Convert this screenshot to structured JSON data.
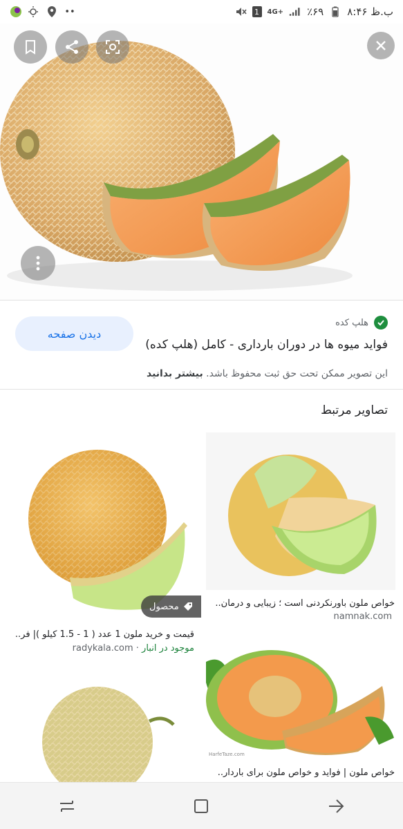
{
  "status_bar": {
    "time": "۸:۴۶ ب.ظ",
    "battery": "٪۶۹",
    "network": "4G+",
    "sim": "1"
  },
  "hero": {
    "image_alt": "melon"
  },
  "result": {
    "source": "هلپ کده",
    "title": "فواید میوه ها در دوران بارداری - کامل (هلپ کده)",
    "visit_button": "دیدن صفحه",
    "copyright": "این تصویر ممکن تحت حق ثبت محفوظ باشد.",
    "learn_more": "بیشتر بدانید"
  },
  "related": {
    "heading": "تصاویر مرتبط",
    "items": [
      {
        "caption": "خواص ملون باورنکردنی است ؛ زیبایی و درمان..",
        "site": "namnak.com"
      },
      {
        "caption": "قیمت و خرید ملون 1 عدد ( 1 - 1.5 کیلو )| فر..",
        "site": "radykala.com",
        "stock": "موجود در انبار",
        "tag": "محصول"
      },
      {
        "caption": "خواص ملون | فواید و خواص ملون برای باردار..",
        "watermark": "HarfeTaze.com"
      },
      {
        "caption": ""
      }
    ]
  }
}
